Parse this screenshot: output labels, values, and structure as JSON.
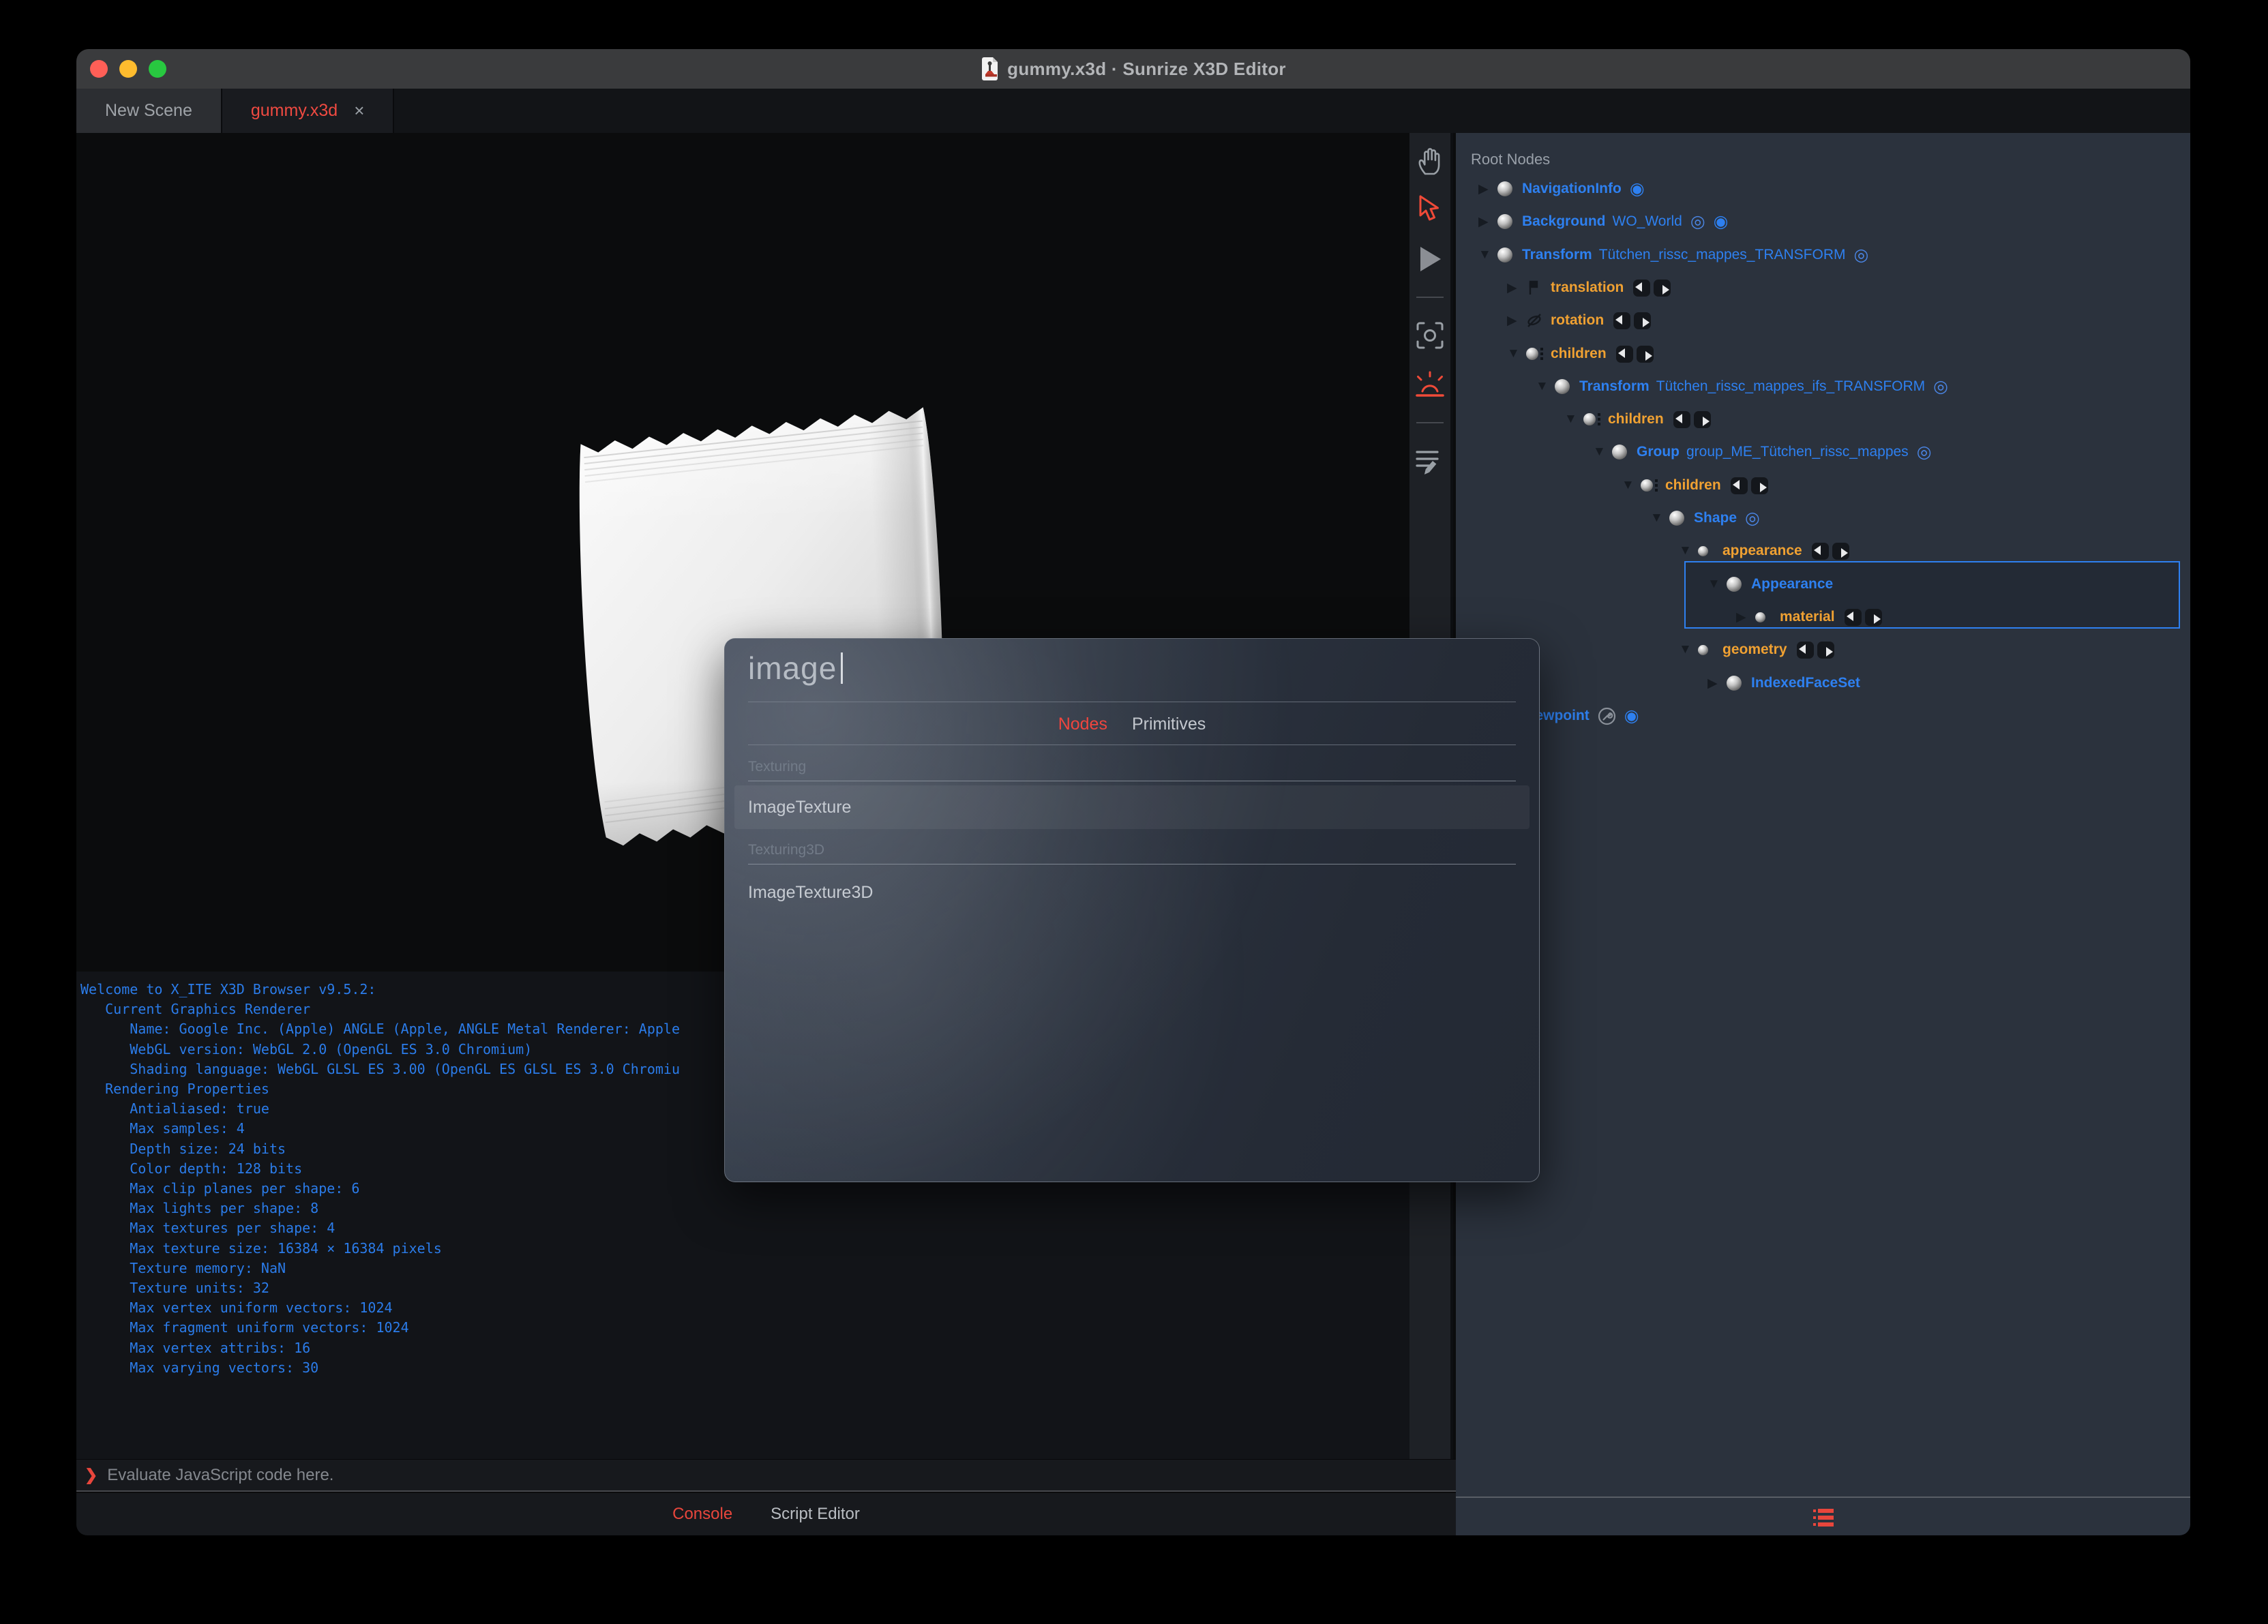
{
  "window": {
    "title": "gummy.x3d · Sunrize X3D Editor",
    "app_icon": "x3d-file-icon"
  },
  "traffic_lights": [
    {
      "name": "close-button",
      "color": "#ff5f57"
    },
    {
      "name": "minimize-button",
      "color": "#febc2e"
    },
    {
      "name": "zoom-button",
      "color": "#28c840"
    }
  ],
  "tabs": [
    {
      "label": "New Scene",
      "active": false
    },
    {
      "label": "gummy.x3d",
      "active": true,
      "close_glyph": "×"
    }
  ],
  "viewport": {
    "content": "packet-3d-render"
  },
  "toolbar": {
    "items": [
      {
        "icon": "hand-pan-icon",
        "active": false
      },
      {
        "icon": "select-arrow-icon",
        "active": true,
        "color": "#f04a38"
      },
      {
        "icon": "play-icon",
        "active": false
      },
      {
        "icon": "separator"
      },
      {
        "icon": "camera-center-icon",
        "active": false
      },
      {
        "icon": "light-icon",
        "active": true,
        "color": "#f04a38"
      },
      {
        "icon": "separator"
      },
      {
        "icon": "script-edit-icon",
        "active": false
      }
    ]
  },
  "outline": {
    "header": "Root Nodes",
    "accent_blue": "#2e80f0",
    "accent_orange": "#f0a132",
    "rows": [
      {
        "level": 0,
        "expander": "collapsed",
        "icon": "node-sphere",
        "type": "NavigationInfo",
        "badges": [
          "bind"
        ]
      },
      {
        "level": 0,
        "expander": "collapsed",
        "icon": "node-sphere",
        "type": "Background",
        "def": "WO_World",
        "badges": [
          "eye",
          "bind"
        ]
      },
      {
        "level": 0,
        "expander": "expanded",
        "icon": "node-sphere",
        "type": "Transform",
        "def": "Tütchen_rissc_mappes_TRANSFORM",
        "badges": [
          "eye"
        ]
      },
      {
        "level": 1,
        "expander": "collapsed",
        "icon": "translation-glyph",
        "field": "translation",
        "badges": [
          "routes"
        ]
      },
      {
        "level": 1,
        "expander": "collapsed",
        "icon": "rotation-glyph",
        "field": "rotation",
        "badges": [
          "routes"
        ]
      },
      {
        "level": 1,
        "expander": "expanded",
        "icon": "sphere-dots",
        "field": "children",
        "badges": [
          "routes"
        ]
      },
      {
        "level": 2,
        "expander": "expanded",
        "icon": "node-sphere",
        "type": "Transform",
        "def": "Tütchen_rissc_mappes_ifs_TRANSFORM",
        "badges": [
          "eye"
        ]
      },
      {
        "level": 3,
        "expander": "expanded",
        "icon": "sphere-dots",
        "field": "children",
        "badges": [
          "routes"
        ]
      },
      {
        "level": 4,
        "expander": "expanded",
        "icon": "node-sphere",
        "type": "Group",
        "def": "group_ME_Tütchen_rissc_mappes",
        "badges": [
          "eye"
        ]
      },
      {
        "level": 5,
        "expander": "expanded",
        "icon": "sphere-dots",
        "field": "children",
        "badges": [
          "routes"
        ]
      },
      {
        "level": 6,
        "expander": "expanded",
        "icon": "node-sphere",
        "type": "Shape",
        "badges": [
          "eye"
        ]
      },
      {
        "level": 7,
        "expander": "expanded",
        "icon": "field-sphere",
        "field": "appearance",
        "badges": [
          "routes"
        ]
      },
      {
        "level": 8,
        "expander": "expanded",
        "icon": "node-sphere",
        "type": "Appearance",
        "badges": [],
        "selected": true
      },
      {
        "level": 9,
        "expander": "collapsed",
        "icon": "field-sphere",
        "field": "material",
        "badges": [
          "routes"
        ],
        "selected": true
      },
      {
        "level": 7,
        "expander": "expanded",
        "icon": "field-sphere",
        "field": "geometry",
        "badges": [
          "routes"
        ]
      },
      {
        "level": 8,
        "expander": "collapsed",
        "icon": "node-sphere",
        "type": "IndexedFaceSet",
        "badges": []
      },
      {
        "level": 0,
        "expander": "collapsed",
        "icon": "node-sphere",
        "type": "Viewpoint",
        "badges": [
          "wrench",
          "bind"
        ]
      }
    ]
  },
  "dialog": {
    "search": {
      "value": "image"
    },
    "tabs": [
      {
        "label": "Nodes",
        "active": true
      },
      {
        "label": "Primitives",
        "active": false
      }
    ],
    "sections": [
      {
        "label": "Texturing",
        "items": [
          {
            "label": "ImageTexture",
            "highlighted": true
          }
        ]
      },
      {
        "label": "Texturing3D",
        "items": [
          {
            "label": "ImageTexture3D",
            "highlighted": false
          }
        ]
      }
    ],
    "accent_red": "#ef453e"
  },
  "console": {
    "text_color": "#2b7cea",
    "lines": [
      "Welcome to X_ITE X3D Browser v9.5.2:",
      "   Current Graphics Renderer",
      "      Name: Google Inc. (Apple) ANGLE (Apple, ANGLE Metal Renderer: Apple",
      "      WebGL version: WebGL 2.0 (OpenGL ES 3.0 Chromium)",
      "      Shading language: WebGL GLSL ES 3.00 (OpenGL ES GLSL ES 3.0 Chromiu",
      "   Rendering Properties",
      "      Antialiased: true",
      "      Max samples: 4",
      "      Depth size: 24 bits",
      "      Color depth: 128 bits",
      "      Max clip planes per shape: 6",
      "      Max lights per shape: 8",
      "      Max textures per shape: 4",
      "      Max texture size: 16384 × 16384 pixels",
      "      Texture memory: NaN",
      "      Texture units: 32",
      "      Max vertex uniform vectors: 1024",
      "      Max fragment uniform vectors: 1024",
      "      Max vertex attribs: 16",
      "      Max varying vectors: 30"
    ],
    "prompt": {
      "chevron": "❯",
      "placeholder": "Evaluate JavaScript code here."
    },
    "tabs": [
      {
        "label": "Console",
        "active": true
      },
      {
        "label": "Script Editor",
        "active": false
      }
    ]
  },
  "right_footer": {
    "icon": "outline-list-icon",
    "color": "#e8463c"
  }
}
